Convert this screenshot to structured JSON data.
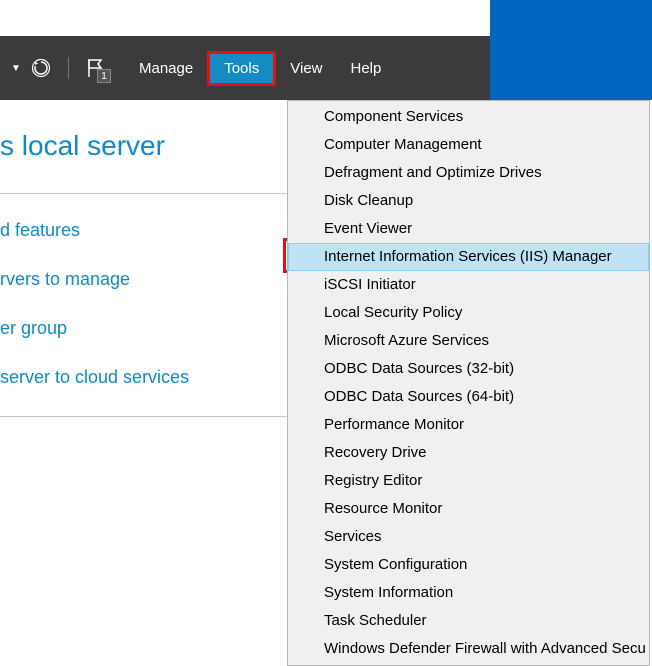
{
  "titlebar": {
    "minimize": "−",
    "maximize": "□",
    "close": "×"
  },
  "menubar": {
    "flag_badge": "1",
    "items": {
      "manage": "Manage",
      "tools": "Tools",
      "view": "View",
      "help": "Help"
    }
  },
  "page": {
    "title": "s local server",
    "links": [
      "d features",
      "rvers to manage",
      "er group",
      "server to cloud services"
    ]
  },
  "dropdown": {
    "items": [
      "Component Services",
      "Computer Management",
      "Defragment and Optimize Drives",
      "Disk Cleanup",
      "Event Viewer",
      "Internet Information Services (IIS) Manager",
      "iSCSI Initiator",
      "Local Security Policy",
      "Microsoft Azure Services",
      "ODBC Data Sources (32-bit)",
      "ODBC Data Sources (64-bit)",
      "Performance Monitor",
      "Recovery Drive",
      "Registry Editor",
      "Resource Monitor",
      "Services",
      "System Configuration",
      "System Information",
      "Task Scheduler",
      "Windows Defender Firewall with Advanced Secu"
    ],
    "highlight_index": 5
  },
  "colors": {
    "accent": "#158bc4",
    "link": "#1089c7",
    "highlight_red": "#e11212",
    "menu_bg": "#3b3b3b"
  }
}
